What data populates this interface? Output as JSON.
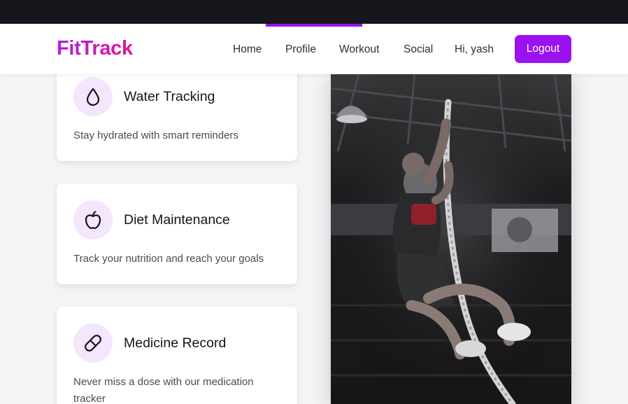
{
  "brand": {
    "logo": "FitTrack",
    "accent_color": "#9b12ef"
  },
  "nav": {
    "links": [
      "Home",
      "Profile",
      "Workout",
      "Social"
    ],
    "greeting": "Hi, yash",
    "logout_label": "Logout"
  },
  "features": [
    {
      "title": "Water Tracking",
      "description": "Stay hydrated with smart reminders",
      "icon": "droplet-icon"
    },
    {
      "title": "Diet Maintenance",
      "description": "Track your nutrition and reach your goals",
      "icon": "apple-icon"
    },
    {
      "title": "Medicine Record",
      "description": "Never miss a dose with our medication tracker",
      "icon": "pill-icon"
    }
  ],
  "hero_image": {
    "subject": "athlete climbing rope in gym"
  }
}
